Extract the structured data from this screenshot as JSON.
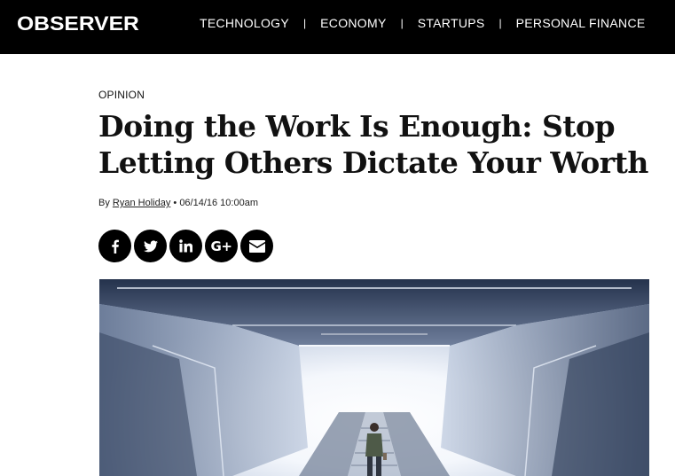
{
  "header": {
    "logo": "OBSERVER",
    "nav": [
      {
        "label": "TECHNOLOGY"
      },
      {
        "label": "ECONOMY"
      },
      {
        "label": "STARTUPS"
      },
      {
        "label": "PERSONAL FINANCE"
      }
    ],
    "separator": "|"
  },
  "article": {
    "kicker": "OPINION",
    "title": "Doing the Work Is Enough: Stop Letting Others Dictate Your Worth",
    "byline": {
      "prefix": "By",
      "author": "Ryan Holiday",
      "dot": "•",
      "datetime": "06/14/16 10:00am"
    },
    "share_icons": [
      "facebook-icon",
      "twitter-icon",
      "linkedin-icon",
      "google-plus-icon",
      "email-icon"
    ],
    "share_google_label": "G+",
    "hero_image": "escalator-station"
  }
}
